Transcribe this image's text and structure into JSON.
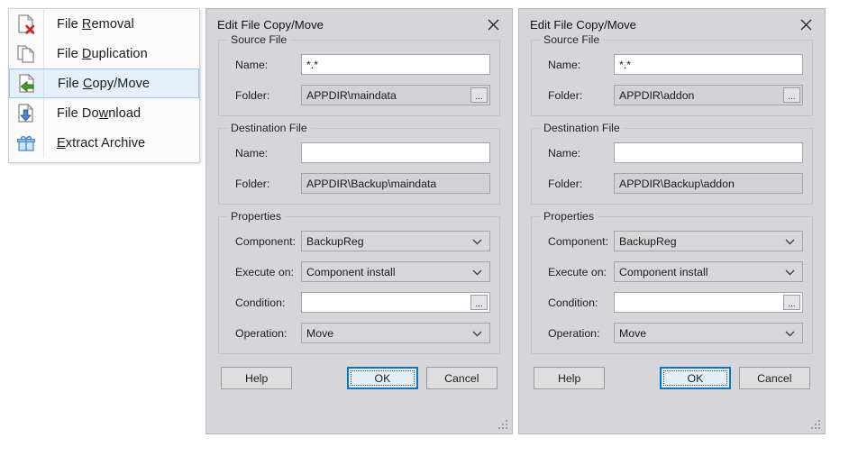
{
  "menu": {
    "items": [
      {
        "label_pre": "File ",
        "accel": "R",
        "label_post": "emoval",
        "icon": "file-remove-icon",
        "selected": false
      },
      {
        "label_pre": "File ",
        "accel": "D",
        "label_post": "uplication",
        "icon": "file-duplicate-icon",
        "selected": false
      },
      {
        "label_pre": "File ",
        "accel": "C",
        "label_post": "opy/Move",
        "icon": "file-copy-move-icon",
        "selected": true
      },
      {
        "label_pre": "File Do",
        "accel": "w",
        "label_post": "nload",
        "icon": "file-download-icon",
        "selected": false
      },
      {
        "label_pre": "",
        "accel": "E",
        "label_post": "xtract Archive",
        "icon": "extract-archive-icon",
        "selected": false
      }
    ]
  },
  "dialogs": [
    {
      "title": "Edit File Copy/Move",
      "close_label": "✕",
      "groups": {
        "source": {
          "title": "Source File",
          "name_label": "Name:",
          "name_value": "*.*",
          "folder_label": "Folder:",
          "folder_value": "APPDIR\\maindata",
          "browse_label": "..."
        },
        "destination": {
          "title": "Destination File",
          "name_label": "Name:",
          "name_value": "",
          "folder_label": "Folder:",
          "folder_value": "APPDIR\\Backup\\maindata"
        },
        "properties": {
          "title": "Properties",
          "component_label": "Component:",
          "component_value": "BackupReg",
          "execute_label": "Execute on:",
          "execute_value": "Component install",
          "condition_label": "Condition:",
          "condition_value": "",
          "condition_browse_label": "...",
          "operation_label": "Operation:",
          "operation_value": "Move"
        }
      },
      "buttons": {
        "help": "Help",
        "ok": "OK",
        "cancel": "Cancel"
      }
    },
    {
      "title": "Edit File Copy/Move",
      "close_label": "✕",
      "groups": {
        "source": {
          "title": "Source File",
          "name_label": "Name:",
          "name_value": "*.*",
          "folder_label": "Folder:",
          "folder_value": "APPDIR\\addon",
          "browse_label": "..."
        },
        "destination": {
          "title": "Destination File",
          "name_label": "Name:",
          "name_value": "",
          "folder_label": "Folder:",
          "folder_value": "APPDIR\\Backup\\addon"
        },
        "properties": {
          "title": "Properties",
          "component_label": "Component:",
          "component_value": "BackupReg",
          "execute_label": "Execute on:",
          "execute_value": "Component install",
          "condition_label": "Condition:",
          "condition_value": "",
          "condition_browse_label": "...",
          "operation_label": "Operation:",
          "operation_value": "Move"
        }
      },
      "buttons": {
        "help": "Help",
        "ok": "OK",
        "cancel": "Cancel"
      }
    }
  ],
  "colors": {
    "dialog_bg": "#d6d6da",
    "selection_bg": "#e4eff9",
    "selection_border": "#9cc8ec",
    "focus_border": "#0a74c8",
    "accent_green": "#4a9c2a",
    "accent_red": "#d02020",
    "accent_blue": "#4a86c8"
  }
}
